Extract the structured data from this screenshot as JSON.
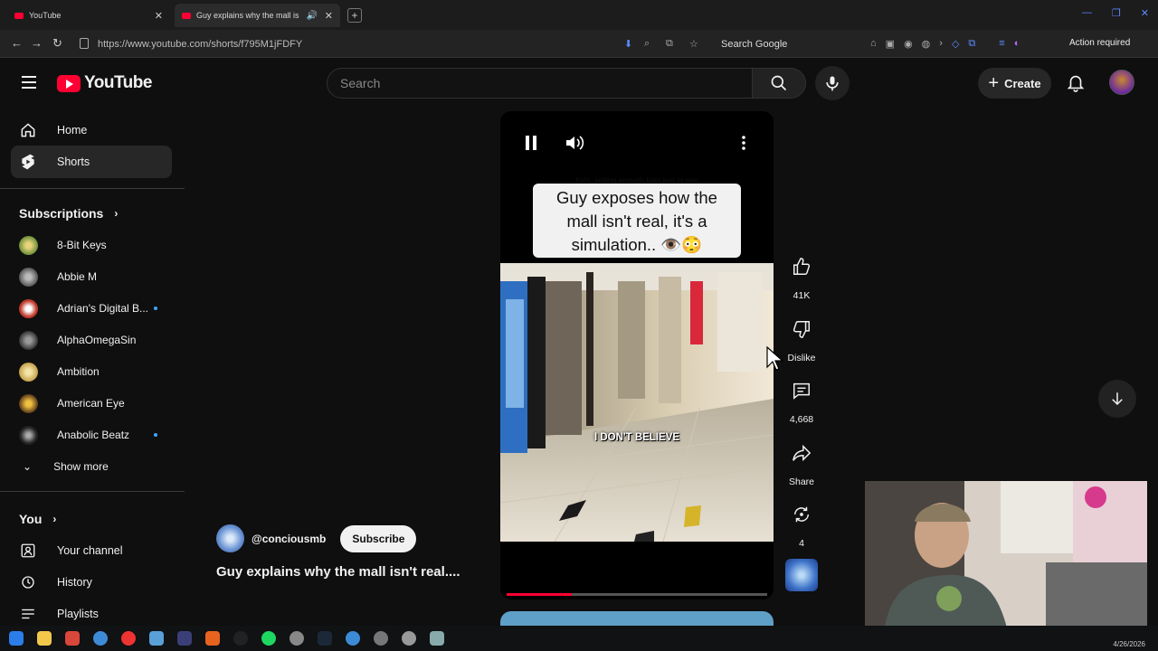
{
  "browser": {
    "tabs": [
      {
        "title": "YouTube",
        "active": false
      },
      {
        "title": "Guy explains why the mall is",
        "active": true
      }
    ],
    "new_tab_label": "+",
    "url": "https://www.youtube.com/shorts/f795M1jFDFY",
    "search_engine_box": "Search Google",
    "action_required": "Action required"
  },
  "header": {
    "logo_text": "YouTube",
    "search_placeholder": "Search",
    "create_label": "Create"
  },
  "sidebar": {
    "main": [
      {
        "label": "Home",
        "icon": "home-icon"
      },
      {
        "label": "Shorts",
        "icon": "shorts-icon",
        "active": true
      }
    ],
    "subscriptions_title": "Subscriptions",
    "subscriptions": [
      {
        "label": "8-Bit Keys",
        "color": "#6b8f3a",
        "new": false
      },
      {
        "label": "Abbie M",
        "color": "#8a8a8a",
        "new": false
      },
      {
        "label": "Adrian's Digital B...",
        "color": "#c0392b",
        "new": true
      },
      {
        "label": "AlphaOmegaSin",
        "color": "#555555",
        "new": false
      },
      {
        "label": "Ambition",
        "color": "#d4b86a",
        "new": false
      },
      {
        "label": "American Eye",
        "color": "#7a5a2a",
        "new": false
      },
      {
        "label": "Anabolic Beatz",
        "color": "#333333",
        "new": true
      }
    ],
    "show_more": "Show more",
    "you_title": "You",
    "you_items": [
      {
        "label": "Your channel",
        "icon": "channel-icon"
      },
      {
        "label": "History",
        "icon": "history-icon"
      },
      {
        "label": "Playlists",
        "icon": "playlists-icon"
      }
    ]
  },
  "player": {
    "caption_overlay": "hats, selling enough hats just to pay two employees. No, I don't",
    "caption_title_lines": [
      "Guy exposes how the",
      "mall isn't real, it's a",
      "simulation.. 👁️😳"
    ],
    "video_caption": "I DON'T BELIEVE",
    "progress": 0.25
  },
  "actions": {
    "likes": "41K",
    "dislike_label": "Dislike",
    "comments": "4,668",
    "share_label": "Share",
    "remix_count": "4"
  },
  "short": {
    "channel": "@conciousmb",
    "subscribe_label": "Subscribe",
    "title": "Guy explains why the mall isn't real...."
  },
  "taskbar": {
    "date": "4/26/2026"
  }
}
